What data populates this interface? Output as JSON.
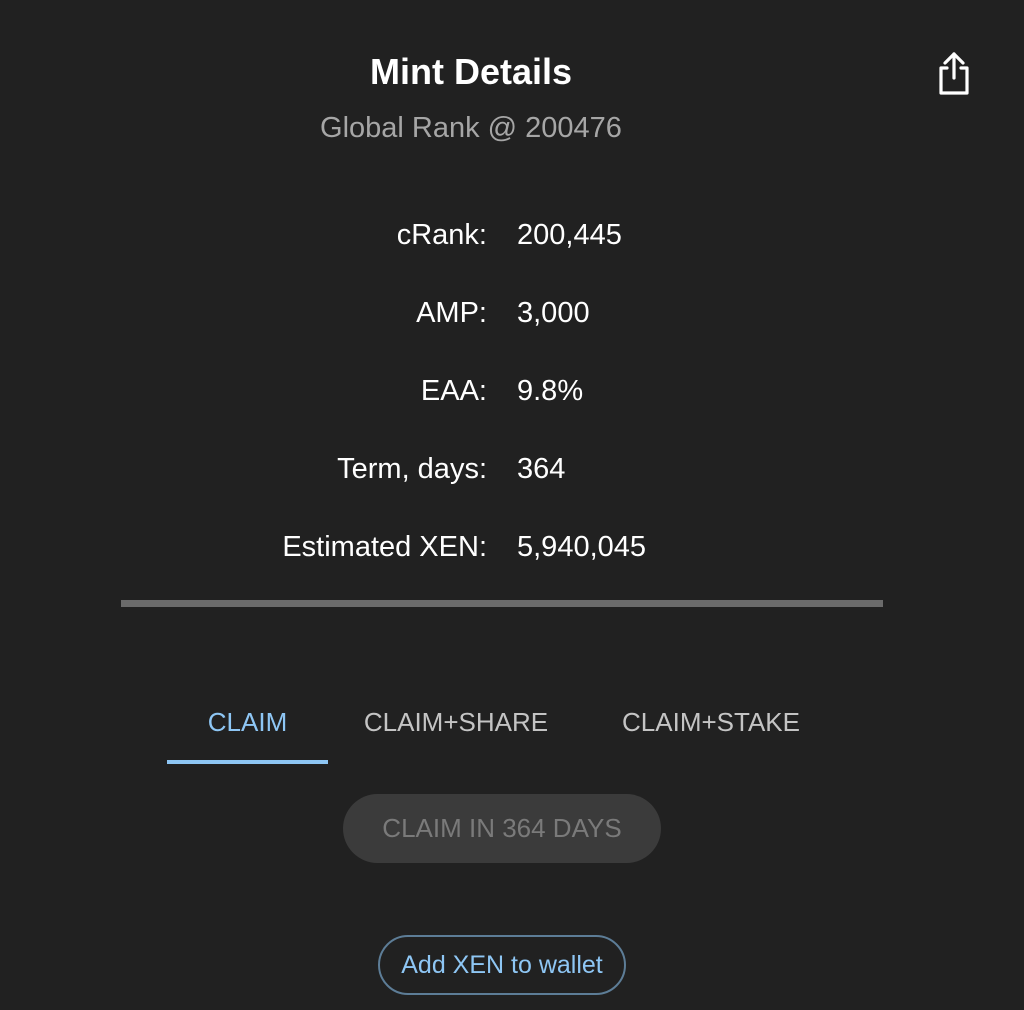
{
  "header": {
    "title": "Mint Details",
    "subtitle": "Global Rank @ 200476",
    "share_icon": "share-icon"
  },
  "details": [
    {
      "label": "cRank:",
      "value": "200,445"
    },
    {
      "label": "AMP:",
      "value": "3,000"
    },
    {
      "label": "EAA:",
      "value": "9.8%"
    },
    {
      "label": "Term, days:",
      "value": "364"
    },
    {
      "label": "Estimated XEN:",
      "value": "5,940,045"
    }
  ],
  "tabs": [
    {
      "label": "CLAIM",
      "active": true
    },
    {
      "label": "CLAIM+SHARE",
      "active": false
    },
    {
      "label": "CLAIM+STAKE",
      "active": false
    }
  ],
  "claim_button": {
    "label": "CLAIM IN 364 DAYS",
    "disabled": true
  },
  "wallet_button": {
    "label": "Add XEN to wallet"
  },
  "colors": {
    "background": "#212121",
    "accent": "#8ec6f4",
    "muted_text": "#a6a6a6",
    "divider": "#6b6b6b",
    "disabled_button": "#3b3b3b"
  }
}
